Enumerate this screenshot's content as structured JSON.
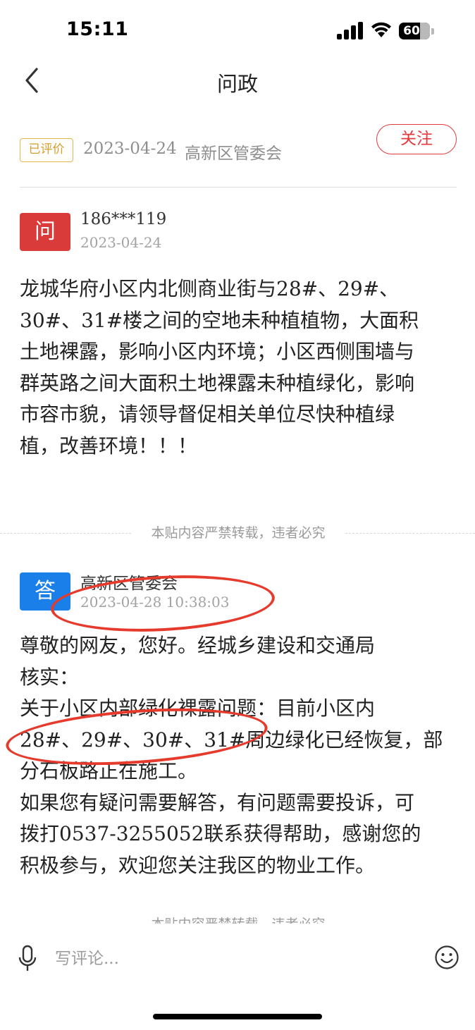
{
  "status_bar": {
    "time": "15:11",
    "battery": "60"
  },
  "nav": {
    "title": "问政"
  },
  "meta": {
    "badge": "已评价",
    "date": "2023-04-24",
    "department": "高新区管委会",
    "follow_label": "关注"
  },
  "question": {
    "avatar_label": "问",
    "user": "186***119",
    "date": "2023-04-24",
    "content": "龙城华府小区内北侧商业街与28#、29#、\n30#、31#楼之间的空地未种植植物，大面积\n土地裸露，影响小区内环境；小区西侧围墙与\n群英路之间大面积土地裸露未种植绿化，影响\n市容市貌，请领导督促相关单位尽快种植绿\n植，改善环境！！！"
  },
  "notice": {
    "text": "本贴内容严禁转载，违者必究"
  },
  "answer": {
    "avatar_label": "答",
    "responder": "高新区管委会",
    "datetime": "2023-04-28 10:38:03",
    "content": "尊敬的网友，您好。经城乡建设和交通局\n核实：\n关于小区内部绿化裸露问题：目前小区内\n28#、29#、30#、31#周边绿化已经恢复，部\n分石板路正在施工。\n如果您有疑问需要解答，有问题需要投诉，可\n拨打0537-3255052联系获得帮助，感谢您的\n积极参与，欢迎您关注我区的物业工作。"
  },
  "comment": {
    "placeholder": "写评论..."
  },
  "colors": {
    "accent_red": "#e4393c",
    "question_red": "#d93a3a",
    "answer_blue": "#1a7fe8",
    "badge_gold": "#d99e2b",
    "annotation_red": "#e53a2c"
  },
  "icons": [
    "signal-icon",
    "wifi-icon",
    "battery-icon",
    "back-icon",
    "mic-icon",
    "emoji-icon"
  ]
}
